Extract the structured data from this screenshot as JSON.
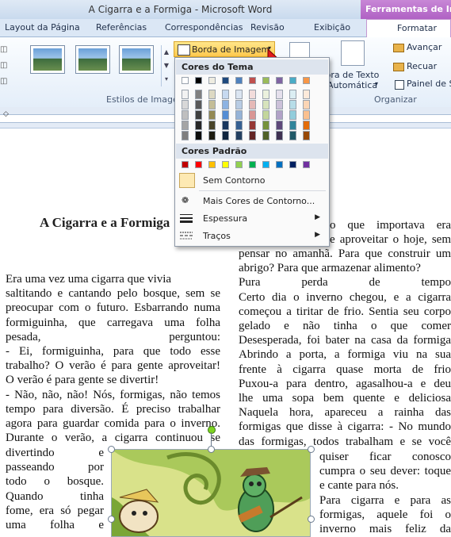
{
  "window": {
    "title": "A Cigarra e a Formiga  -  Microsoft Word",
    "context_title": "Ferramentas de Imagem"
  },
  "tabs": [
    "Layout da Página",
    "Referências",
    "Correspondências",
    "Revisão",
    "Exibição",
    "Formatar"
  ],
  "ribbon": {
    "styles_group_label": "Estilos de Imagem",
    "border_button_label": "Borda de Imagem",
    "wrap_text_label_1": "Quebra de Texto",
    "wrap_text_label_2": "Automática",
    "bring_forward_label": "Avançar",
    "send_backward_label": "Recuar",
    "selection_pane_label": "Painel de S",
    "organize_group_label": "Organizar"
  },
  "dropdown": {
    "theme_colors_header": "Cores do Tema",
    "standard_colors_header": "Cores Padrão",
    "no_outline_label": "Sem Contorno",
    "more_colors_label": "Mais Cores de Contorno...",
    "weight_label": "Espessura",
    "dashes_label": "Traços",
    "theme_colors": [
      "#ffffff",
      "#000000",
      "#eeece1",
      "#1f497d",
      "#4f81bd",
      "#c0504d",
      "#9bbb59",
      "#8064a2",
      "#4bacc6",
      "#f79646"
    ],
    "theme_shades": [
      [
        "#f2f2f2",
        "#d8d8d8",
        "#bfbfbf",
        "#a5a5a5",
        "#7f7f7f"
      ],
      [
        "#7f7f7f",
        "#595959",
        "#3f3f3f",
        "#262626",
        "#0c0c0c"
      ],
      [
        "#ddd9c3",
        "#c4bd97",
        "#938953",
        "#494429",
        "#1d1b10"
      ],
      [
        "#c6d9f0",
        "#8db3e2",
        "#548dd4",
        "#17365d",
        "#0f243e"
      ],
      [
        "#dbe5f1",
        "#b8cce4",
        "#95b3d7",
        "#366092",
        "#244061"
      ],
      [
        "#f2dcdb",
        "#e5b9b7",
        "#d99694",
        "#953734",
        "#632423"
      ],
      [
        "#ebf1dd",
        "#d7e3bc",
        "#c3d69b",
        "#76923c",
        "#4f6128"
      ],
      [
        "#e5e0ec",
        "#ccc1d9",
        "#b2a2c7",
        "#5f497a",
        "#3f3151"
      ],
      [
        "#dbeef3",
        "#b7dde8",
        "#92cddc",
        "#31859b",
        "#205867"
      ],
      [
        "#fdeada",
        "#fbd5b5",
        "#fac08f",
        "#e36c09",
        "#974806"
      ]
    ],
    "standard_colors": [
      "#c00000",
      "#ff0000",
      "#ffc000",
      "#ffff00",
      "#92d050",
      "#00b050",
      "#00b0f0",
      "#0070c0",
      "#002060",
      "#7030a0"
    ]
  },
  "document": {
    "title": "A Cigarra e a Formiga",
    "left_column": [
      "Era uma vez uma cigarra que vivia",
      "saltitando e cantando pelo bosque, sem se",
      "preocupar com o futuro. Esbarrando numa",
      "formiguinha, que carregava uma folha",
      "pesada, perguntou:",
      "- Ei, formiguinha, para que todo esse",
      "trabalho? O verão é para gente aproveitar!",
      "O verão é para gente se divertir!",
      "- Não, não, não! Nós, formigas, não temos",
      "tempo para diversão. É preciso trabalhar",
      "agora para guardar comida para o inverno.",
      "Durante o verão, a cigarra continuou se"
    ],
    "left_column_narrow": [
      "divertindo e",
      "passeando por",
      "todo o bosque.",
      "Quando tinha",
      "fome, era só pegar",
      "uma folha e"
    ],
    "right_column_top": [
      "o que importava era",
      "e aproveitar o hoje, sem"
    ],
    "right_column": [
      "pensar no amanhã. Para que construir um",
      "abrigo? Para que armazenar alimento?",
      "Pura perda de tempo",
      "Certo dia o inverno chegou, e a cigarra",
      "começou a tiritar de frio. Sentia seu corpo",
      "gelado e não tinha o que comer",
      "Desesperada, foi bater na casa da formiga",
      "Abrindo a porta, a formiga viu na sua",
      "frente à cigarra quase morta de frio",
      "Puxou-a para dentro, agasalhou-a e deu",
      "lhe uma sopa bem quente e deliciosa",
      "Naquela hora, apareceu a rainha das",
      "formigas que disse à cigarra: - No mundo",
      "das formigas, todos trabalham e se você"
    ],
    "right_column_narrow": [
      "quiser ficar conosco",
      "cumpra o seu dever: toque",
      "e cante para nós.",
      "Para cigarra e para as",
      "formigas, aquele foi o",
      "inverno mais feliz da"
    ]
  }
}
